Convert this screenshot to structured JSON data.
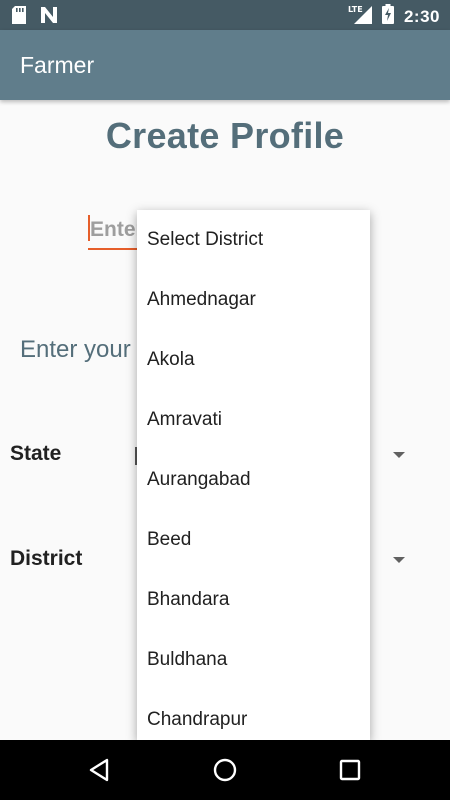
{
  "status_bar": {
    "time": "2:30",
    "network": "LTE",
    "icons": [
      "sd-card-icon",
      "notification-n-icon",
      "lte-signal-icon",
      "battery-charging-icon"
    ]
  },
  "app_bar": {
    "title": "Farmer"
  },
  "page": {
    "title": "Create Profile",
    "name_placeholder": "Enter",
    "enter_your_label": "Enter your"
  },
  "form": {
    "state_label": "State",
    "district_label": "District"
  },
  "dropdown": {
    "items": [
      "Select District",
      "Ahmednagar",
      "Akola",
      "Amravati",
      "Aurangabad",
      "Beed",
      "Bhandara",
      "Buldhana",
      "Chandrapur"
    ]
  },
  "colors": {
    "status_bar": "#455A64",
    "app_bar": "#607D8B",
    "title": "#546E7A",
    "accent": "#E65E2A"
  }
}
